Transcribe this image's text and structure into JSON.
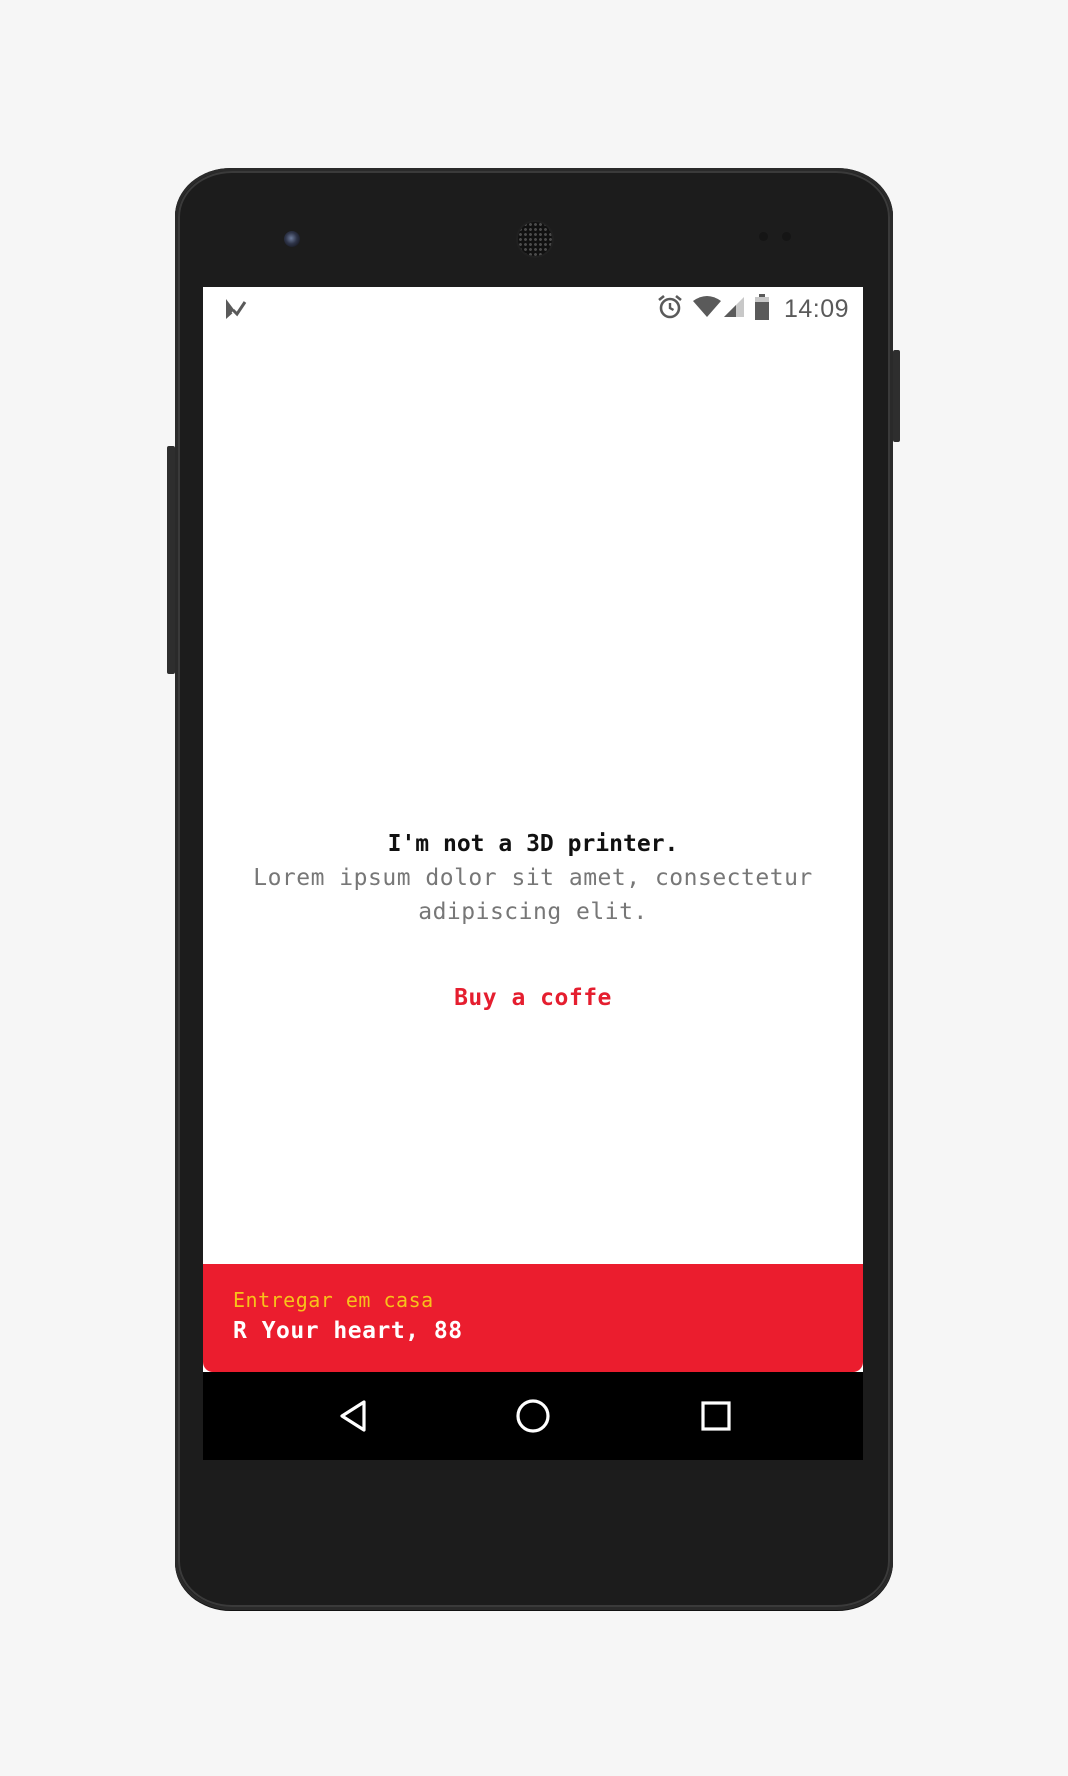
{
  "status_bar": {
    "time": "14:09",
    "icons": [
      "notification-icon",
      "alarm-icon",
      "wifi-icon",
      "signal-icon",
      "battery-icon"
    ]
  },
  "main": {
    "headline": "I'm not a 3D printer.",
    "description": "Lorem ipsum dolor sit amet, consectetur adipiscing elit.",
    "cta_label": "Buy a coffe"
  },
  "delivery": {
    "label": "Entregar em casa",
    "address": "R Your heart, 88"
  },
  "nav_bar": {
    "icons": [
      "back-icon",
      "home-icon",
      "recents-icon"
    ]
  },
  "colors": {
    "accent": "#eb1d2e",
    "label_yellow": "#f7c21a",
    "background": "#ffffff",
    "nav_background": "#000000"
  }
}
